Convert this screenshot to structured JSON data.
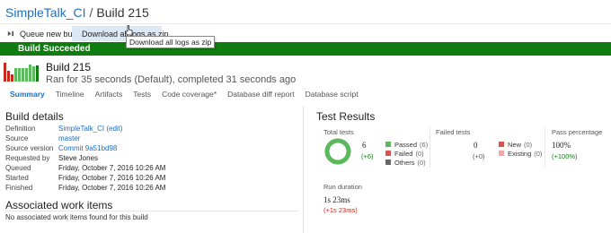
{
  "breadcrumb": {
    "definition": "SimpleTalk_CI",
    "separator": "/",
    "build": "Build 215"
  },
  "toolbar": {
    "queue_label": "Queue new build",
    "download_label": "Download all logs as zip"
  },
  "tooltip": "Download all logs as zip",
  "banner": {
    "text": "Build Succeeded",
    "color": "#107c10"
  },
  "header": {
    "build": "Build 215",
    "meta": "Ran for 35 seconds (Default), completed 31 seconds ago"
  },
  "history_bars": [
    {
      "height": 0.95,
      "color": "#c42b1c"
    },
    {
      "height": 0.55,
      "color": "#c42b1c"
    },
    {
      "height": 0.35,
      "color": "#c42b1c"
    },
    {
      "height": 0.7,
      "color": "#5cb85c"
    },
    {
      "height": 0.7,
      "color": "#5cb85c"
    },
    {
      "height": 0.7,
      "color": "#5cb85c"
    },
    {
      "height": 0.7,
      "color": "#5cb85c"
    },
    {
      "height": 0.85,
      "color": "#5cb85c"
    },
    {
      "height": 0.75,
      "color": "#5cb85c"
    },
    {
      "height": 0.8,
      "color": "#107c10"
    }
  ],
  "tabs": [
    "Summary",
    "Timeline",
    "Artifacts",
    "Tests",
    "Code coverage*",
    "Database diff report",
    "Database script"
  ],
  "build_details": {
    "title": "Build details",
    "rows": [
      {
        "key": "Definition",
        "value": "SimpleTalk_CI (edit)",
        "link": true
      },
      {
        "key": "Source",
        "value": "master",
        "link": true
      },
      {
        "key": "Source version",
        "value": "Commit 9a51bd98",
        "link": true
      },
      {
        "key": "Requested by",
        "value": "Steve Jones",
        "link": false
      },
      {
        "key": "Queued",
        "value": "Friday, October 7, 2016 10:26 AM",
        "link": false
      },
      {
        "key": "Started",
        "value": "Friday, October 7, 2016 10:26 AM",
        "link": false
      },
      {
        "key": "Finished",
        "value": "Friday, October 7, 2016 10:26 AM",
        "link": false
      }
    ]
  },
  "work_items": {
    "title": "Associated work items",
    "empty": "No associated work items found for this build"
  },
  "test_results": {
    "title": "Test Results",
    "total": {
      "label": "Total tests",
      "value": "6",
      "delta": "(+6)",
      "passed_fraction": 1.0
    },
    "legend": [
      {
        "label": "Passed",
        "count": "(6)",
        "color": "#5cb85c"
      },
      {
        "label": "Failed",
        "count": "(0)",
        "color": "#d9534f"
      },
      {
        "label": "Others",
        "count": "(0)",
        "color": "#666666"
      }
    ],
    "failed": {
      "label": "Failed tests",
      "value": "0",
      "delta": "(+0)"
    },
    "failed_legend": [
      {
        "label": "New",
        "count": "(0)",
        "color": "#d9534f"
      },
      {
        "label": "Existing",
        "count": "(0)",
        "color": "#f4a6a6"
      }
    ],
    "pass_pct": {
      "label": "Pass percentage",
      "value": "100%",
      "delta": "(+100%)"
    },
    "duration": {
      "label": "Run duration",
      "value": "1s 23ms",
      "delta": "(+1s 23ms)"
    }
  }
}
